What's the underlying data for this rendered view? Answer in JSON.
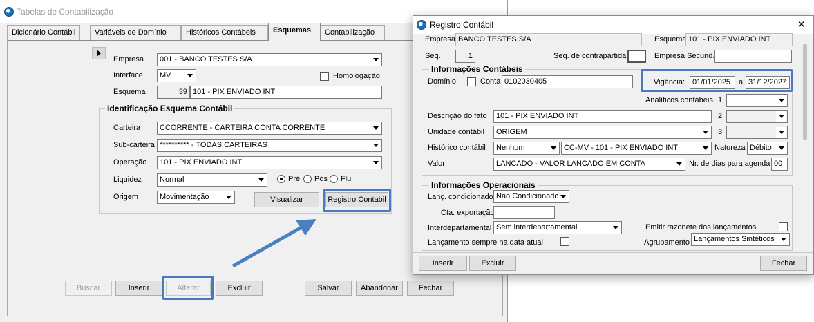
{
  "colors": {
    "highlight": "#4a78c2",
    "arrow": "#4a7fc4"
  },
  "main": {
    "title": "Tabelas de Contabilização",
    "tabs": [
      "Dicionário Contábil",
      "Variáveis de Domínio",
      "Históricos Contábeis",
      "Esquemas",
      "Contabilização"
    ],
    "empresa_label": "Empresa",
    "empresa_value": "001 - BANCO TESTES S/A",
    "interface_label": "Interface",
    "interface_value": "MV",
    "homologacao_label": "Homologação",
    "esquema_label": "Esquema",
    "esquema_code": "39",
    "esquema_value": "101 - PIX ENVIADO INT",
    "group_title": "Identificação Esquema Contábil",
    "carteira_label": "Carteira",
    "carteira_value": "CCORRENTE - CARTEIRA CONTA CORRENTE",
    "subcarteira_label": "Sub-carteira",
    "subcarteira_value": "********** - TODAS CARTEIRAS",
    "operacao_label": "Operação",
    "operacao_value": "101 - PIX ENVIADO INT",
    "liquidez_label": "Liquidez",
    "liquidez_value": "Normal",
    "radio_pre": "Pré",
    "radio_pos": "Pós",
    "radio_flu": "Flu",
    "origem_label": "Origem",
    "origem_value": "Movimentação",
    "visualizar": "Visualizar",
    "registro_contabil": "Registro Contabil",
    "buttons": {
      "buscar": "Buscar",
      "inserir": "Inserir",
      "alterar": "Alterar",
      "excluir": "Excluir",
      "salvar": "Salvar",
      "abandonar": "Abandonar",
      "fechar": "Fechar"
    }
  },
  "dialog": {
    "title": "Registro Contábil",
    "empresa_label": "Empresa",
    "empresa_value": "BANCO TESTES S/A",
    "esquema_label": "Esquema",
    "esquema_value": "101 - PIX ENVIADO INT",
    "seq_label": "Seq.",
    "seq_value": "1",
    "seq_contra_label": "Seq. de contrapartida",
    "empresa_secund_label": "Empresa Secund.",
    "info_contabeis": "Informações Contábeis",
    "dominio_label": "Domínio",
    "conta_label": "Conta",
    "conta_value": "0102030405",
    "vigencia_label": "Vigência:",
    "vig_start": "01/01/2025",
    "vig_sep": "a",
    "vig_end": "31/12/2027",
    "analiticos_label": "Analíticos contábeis",
    "n1": "1",
    "n2": "2",
    "n3": "3",
    "descricao_label": "Descrição do fato",
    "descricao_value": "101 - PIX ENVIADO INT",
    "unidade_label": "Unidade contábil",
    "unidade_value": "ORIGEM",
    "historico_label": "Histórico contábil",
    "historico_value": "Nenhum",
    "historico_value2": "CC-MV - 101 - PIX ENVIADO INT",
    "natureza_label": "Natureza",
    "natureza_value": "Débito",
    "valor_label": "Valor",
    "valor_value": "LANCADO - VALOR LANCADO EM CONTA",
    "nr_dias_label": "Nr. de dias para agenda",
    "nr_dias_value": "00",
    "info_operacionais": "Informações Operacionais",
    "lanc_cond_label": "Lanç. condicionado",
    "lanc_cond_value": "Não Condicionado",
    "cta_export_label": "Cta. exportação",
    "interdep_label": "Interdepartamental",
    "interdep_value": "Sem interdepartamental",
    "emitir_label": "Emitir razonete dos lançamentos",
    "lanc_sempre_label": "Lançamento sempre na data atual",
    "agrupamento_label": "Agrupamento",
    "agrupamento_value": "Lançamentos Sintéticos",
    "inserir": "Inserir",
    "excluir": "Excluir",
    "fechar": "Fechar",
    "close_glyph": "✕"
  }
}
